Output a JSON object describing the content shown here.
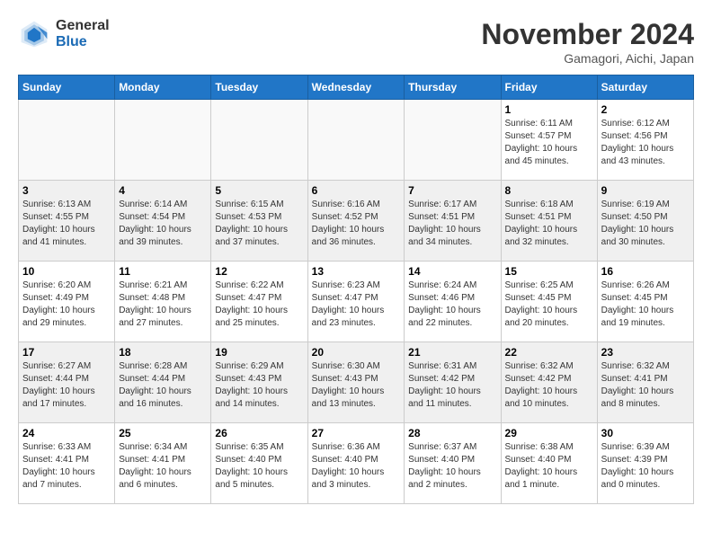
{
  "logo": {
    "general": "General",
    "blue": "Blue"
  },
  "title": "November 2024",
  "location": "Gamagori, Aichi, Japan",
  "days_header": [
    "Sunday",
    "Monday",
    "Tuesday",
    "Wednesday",
    "Thursday",
    "Friday",
    "Saturday"
  ],
  "weeks": [
    {
      "shaded": false,
      "days": [
        {
          "num": "",
          "info": ""
        },
        {
          "num": "",
          "info": ""
        },
        {
          "num": "",
          "info": ""
        },
        {
          "num": "",
          "info": ""
        },
        {
          "num": "",
          "info": ""
        },
        {
          "num": "1",
          "info": "Sunrise: 6:11 AM\nSunset: 4:57 PM\nDaylight: 10 hours\nand 45 minutes."
        },
        {
          "num": "2",
          "info": "Sunrise: 6:12 AM\nSunset: 4:56 PM\nDaylight: 10 hours\nand 43 minutes."
        }
      ]
    },
    {
      "shaded": true,
      "days": [
        {
          "num": "3",
          "info": "Sunrise: 6:13 AM\nSunset: 4:55 PM\nDaylight: 10 hours\nand 41 minutes."
        },
        {
          "num": "4",
          "info": "Sunrise: 6:14 AM\nSunset: 4:54 PM\nDaylight: 10 hours\nand 39 minutes."
        },
        {
          "num": "5",
          "info": "Sunrise: 6:15 AM\nSunset: 4:53 PM\nDaylight: 10 hours\nand 37 minutes."
        },
        {
          "num": "6",
          "info": "Sunrise: 6:16 AM\nSunset: 4:52 PM\nDaylight: 10 hours\nand 36 minutes."
        },
        {
          "num": "7",
          "info": "Sunrise: 6:17 AM\nSunset: 4:51 PM\nDaylight: 10 hours\nand 34 minutes."
        },
        {
          "num": "8",
          "info": "Sunrise: 6:18 AM\nSunset: 4:51 PM\nDaylight: 10 hours\nand 32 minutes."
        },
        {
          "num": "9",
          "info": "Sunrise: 6:19 AM\nSunset: 4:50 PM\nDaylight: 10 hours\nand 30 minutes."
        }
      ]
    },
    {
      "shaded": false,
      "days": [
        {
          "num": "10",
          "info": "Sunrise: 6:20 AM\nSunset: 4:49 PM\nDaylight: 10 hours\nand 29 minutes."
        },
        {
          "num": "11",
          "info": "Sunrise: 6:21 AM\nSunset: 4:48 PM\nDaylight: 10 hours\nand 27 minutes."
        },
        {
          "num": "12",
          "info": "Sunrise: 6:22 AM\nSunset: 4:47 PM\nDaylight: 10 hours\nand 25 minutes."
        },
        {
          "num": "13",
          "info": "Sunrise: 6:23 AM\nSunset: 4:47 PM\nDaylight: 10 hours\nand 23 minutes."
        },
        {
          "num": "14",
          "info": "Sunrise: 6:24 AM\nSunset: 4:46 PM\nDaylight: 10 hours\nand 22 minutes."
        },
        {
          "num": "15",
          "info": "Sunrise: 6:25 AM\nSunset: 4:45 PM\nDaylight: 10 hours\nand 20 minutes."
        },
        {
          "num": "16",
          "info": "Sunrise: 6:26 AM\nSunset: 4:45 PM\nDaylight: 10 hours\nand 19 minutes."
        }
      ]
    },
    {
      "shaded": true,
      "days": [
        {
          "num": "17",
          "info": "Sunrise: 6:27 AM\nSunset: 4:44 PM\nDaylight: 10 hours\nand 17 minutes."
        },
        {
          "num": "18",
          "info": "Sunrise: 6:28 AM\nSunset: 4:44 PM\nDaylight: 10 hours\nand 16 minutes."
        },
        {
          "num": "19",
          "info": "Sunrise: 6:29 AM\nSunset: 4:43 PM\nDaylight: 10 hours\nand 14 minutes."
        },
        {
          "num": "20",
          "info": "Sunrise: 6:30 AM\nSunset: 4:43 PM\nDaylight: 10 hours\nand 13 minutes."
        },
        {
          "num": "21",
          "info": "Sunrise: 6:31 AM\nSunset: 4:42 PM\nDaylight: 10 hours\nand 11 minutes."
        },
        {
          "num": "22",
          "info": "Sunrise: 6:32 AM\nSunset: 4:42 PM\nDaylight: 10 hours\nand 10 minutes."
        },
        {
          "num": "23",
          "info": "Sunrise: 6:32 AM\nSunset: 4:41 PM\nDaylight: 10 hours\nand 8 minutes."
        }
      ]
    },
    {
      "shaded": false,
      "days": [
        {
          "num": "24",
          "info": "Sunrise: 6:33 AM\nSunset: 4:41 PM\nDaylight: 10 hours\nand 7 minutes."
        },
        {
          "num": "25",
          "info": "Sunrise: 6:34 AM\nSunset: 4:41 PM\nDaylight: 10 hours\nand 6 minutes."
        },
        {
          "num": "26",
          "info": "Sunrise: 6:35 AM\nSunset: 4:40 PM\nDaylight: 10 hours\nand 5 minutes."
        },
        {
          "num": "27",
          "info": "Sunrise: 6:36 AM\nSunset: 4:40 PM\nDaylight: 10 hours\nand 3 minutes."
        },
        {
          "num": "28",
          "info": "Sunrise: 6:37 AM\nSunset: 4:40 PM\nDaylight: 10 hours\nand 2 minutes."
        },
        {
          "num": "29",
          "info": "Sunrise: 6:38 AM\nSunset: 4:40 PM\nDaylight: 10 hours\nand 1 minute."
        },
        {
          "num": "30",
          "info": "Sunrise: 6:39 AM\nSunset: 4:39 PM\nDaylight: 10 hours\nand 0 minutes."
        }
      ]
    }
  ]
}
